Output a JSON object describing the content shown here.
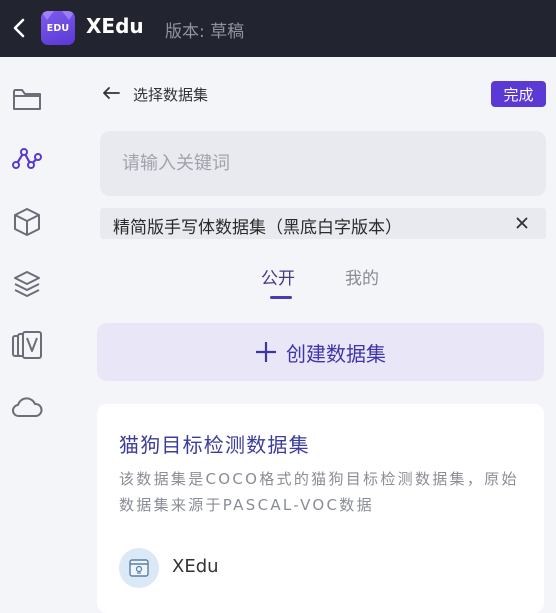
{
  "header": {
    "logo_text": "EDU",
    "app_title": "XEdu",
    "version": "版本: 草稿",
    "logo_colors": [
      "#7d5cf0",
      "#5a39d4"
    ],
    "icons": [
      "chevron-left-icon"
    ]
  },
  "sidebar": {
    "icons": [
      "folder-icon",
      "graph-nodes-icon",
      "cube-icon",
      "layers-icon",
      "model-cards-icon",
      "cloud-icon"
    ],
    "active_item": "graph-nodes-icon"
  },
  "panel": {
    "title": "选择数据集",
    "done_label": "完成",
    "search_placeholder": "请输入关键词",
    "selected_dataset": "精简版手写体数据集（黑底白字版本）",
    "tabs": [
      {
        "label": "公开",
        "active": true
      },
      {
        "label": "我的",
        "active": false
      }
    ],
    "create_label": "创建数据集",
    "accent_color": "#5a39d4"
  },
  "datasets": [
    {
      "title": "猫狗目标检测数据集",
      "description": "该数据集是COCO格式的猫狗目标检测数据集，原始数据集来源于PASCAL-VOC数据",
      "owner": "XEdu"
    }
  ]
}
